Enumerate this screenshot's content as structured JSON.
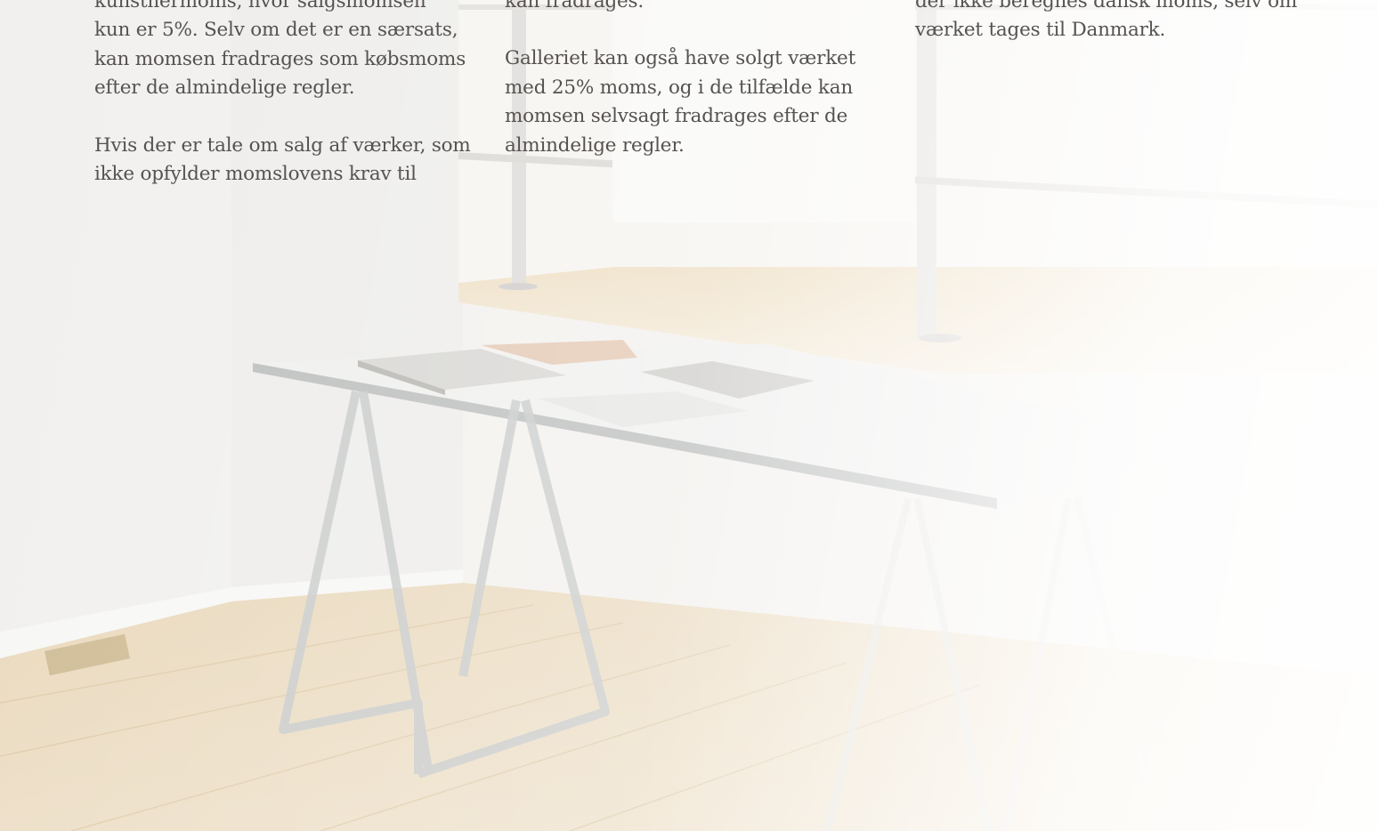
{
  "columns": [
    {
      "paragraphs": [
        [
          "kunstnermoms, hvor salgsmomsen",
          "kun er 5%. Selv om det er en særsats,",
          "kan momsen fradrages som købsmoms",
          "efter de almindelige regler."
        ],
        [
          "Hvis der er tale om salg af værker, som",
          "ikke opfylder momslovens krav til"
        ]
      ]
    },
    {
      "paragraphs": [
        [
          "kan fradrages."
        ],
        [
          "Galleriet kan også have solgt værket",
          "med 25% moms, og i de tilfælde kan",
          "momsen selvsagt fradrages efter de",
          "almindelige regler."
        ]
      ]
    },
    {
      "paragraphs": [
        [
          "der ikke beregnes dansk moms, selv om",
          "værket tages til Danmark."
        ]
      ]
    }
  ],
  "colors": {
    "text": "#555250",
    "wall": "#f3f1ee",
    "floor": "#e6d4b6"
  }
}
